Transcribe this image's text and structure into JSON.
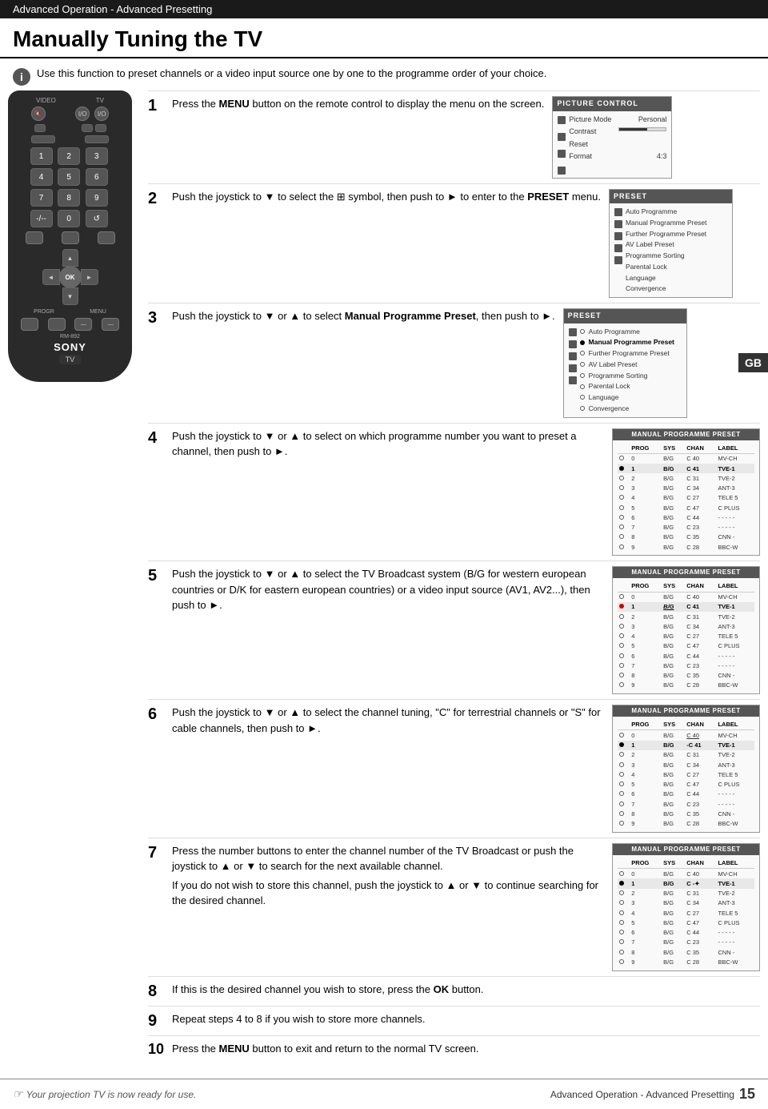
{
  "header": {
    "subtitle": "Advanced Operation - Advanced Presetting",
    "title": "Manually Tuning the TV"
  },
  "intro": {
    "text": "Use this function to preset channels or a video input source one by one to the programme order of your choice."
  },
  "steps": [
    {
      "number": "1",
      "text": "Press the MENU button on the remote control to display the menu on the screen."
    },
    {
      "number": "2",
      "text": "Push the joystick to ▼ to select the  symbol, then push to ► to enter to the PRESET menu."
    },
    {
      "number": "3",
      "text": "Push the joystick to ▼ or ▲ to select Manual Programme Preset, then push to ►."
    },
    {
      "number": "4",
      "text": "Push the joystick to ▼ or ▲ to select on which programme number you want to preset a channel, then push to ►."
    },
    {
      "number": "5",
      "text": "Push the joystick to ▼ or ▲ to select the TV Broadcast system (B/G for western european countries or D/K for eastern european countries) or a video input source (AV1, AV2...), then push to ►."
    },
    {
      "number": "6",
      "text": "Push the joystick to ▼ or ▲ to select the channel tuning, \"C\" for terrestrial channels or \"S\" for cable channels, then push to ►."
    },
    {
      "number": "7",
      "text1": "Press the number buttons to enter the channel number of the TV Broadcast or push the joystick to ▲ or ▼ to search for the next available channel.",
      "text2": "If you do not wish to store this channel, push the joystick to ▲ or ▼ to continue searching for the desired channel."
    },
    {
      "number": "8",
      "text": "If this is the desired channel you wish to store, press the OK button."
    },
    {
      "number": "9",
      "text": "Repeat steps 4 to 8 if you wish to store more channels."
    },
    {
      "number": "10",
      "text": "Press the MENU button to exit and return to the normal TV screen."
    }
  ],
  "picture_control": {
    "title": "PICTURE CONTROL",
    "items": [
      {
        "label": "Picture Mode",
        "value": "Personal"
      },
      {
        "label": "Contrast",
        "value": "bar"
      },
      {
        "label": "Reset",
        "value": ""
      },
      {
        "label": "Format",
        "value": "4:3"
      }
    ]
  },
  "preset_menu_1": {
    "title": "PRESET",
    "items": [
      "Auto Programme",
      "Manual Programme Preset",
      "Further Programme Preset",
      "AV Label Preset",
      "Programme Sorting",
      "Parental Lock",
      "Language",
      "Convergence"
    ]
  },
  "preset_menu_2": {
    "title": "PRESET",
    "items": [
      {
        "label": "Auto Programme",
        "selected": false
      },
      {
        "label": "Manual Programme Preset",
        "selected": true
      },
      {
        "label": "Further Programme Preset",
        "selected": false
      },
      {
        "label": "AV Label Preset",
        "selected": false
      },
      {
        "label": "Programme Sorting",
        "selected": false
      },
      {
        "label": "Parental Lock",
        "selected": false
      },
      {
        "label": "Language",
        "selected": false
      },
      {
        "label": "Convergence",
        "selected": false
      }
    ]
  },
  "mpp_table": {
    "title": "MANUAL PROGRAMME PRESET",
    "headers": [
      "PROG",
      "SYS",
      "CHAN",
      "LABEL"
    ],
    "rows": [
      {
        "prog": "0",
        "sys": "B/G",
        "chan": "C 40",
        "label": "MV-CH",
        "state": "empty"
      },
      {
        "prog": "1",
        "sys": "B/G",
        "chan": "C 41",
        "label": "TVE-1",
        "state": "filled"
      },
      {
        "prog": "2",
        "sys": "B/G",
        "chan": "C 31",
        "label": "TVE-2",
        "state": "empty"
      },
      {
        "prog": "3",
        "sys": "B/G",
        "chan": "C 34",
        "label": "ANT-3",
        "state": "empty"
      },
      {
        "prog": "4",
        "sys": "B/G",
        "chan": "C 27",
        "label": "TELE 5",
        "state": "empty"
      },
      {
        "prog": "5",
        "sys": "B/G",
        "chan": "C 47",
        "label": "C PLUS",
        "state": "empty"
      },
      {
        "prog": "6",
        "sys": "B/G",
        "chan": "C 44",
        "label": "- - - - -",
        "state": "empty"
      },
      {
        "prog": "7",
        "sys": "B/G",
        "chan": "C 23",
        "label": "- - - - -",
        "state": "empty"
      },
      {
        "prog": "8",
        "sys": "B/G",
        "chan": "C 35",
        "label": "CNN -",
        "state": "empty"
      },
      {
        "prog": "9",
        "sys": "B/G",
        "chan": "C 28",
        "label": "BBC-W",
        "state": "empty"
      }
    ]
  },
  "mpp_table_5": {
    "title": "MANUAL PROGRAMME PRESET",
    "highlight_row": 1,
    "rows": [
      {
        "prog": "0",
        "sys": "B/G",
        "chan": "C 40",
        "label": "MV-CH",
        "state": "empty"
      },
      {
        "prog": "1",
        "sys": "-B/G-",
        "chan": "C 41",
        "label": "TVE-1",
        "state": "filled-red"
      },
      {
        "prog": "2",
        "sys": "B/G",
        "chan": "C 31",
        "label": "TVE-2",
        "state": "empty"
      },
      {
        "prog": "3",
        "sys": "B/G",
        "chan": "C 34",
        "label": "ANT-3",
        "state": "empty"
      },
      {
        "prog": "4",
        "sys": "B/G",
        "chan": "C 27",
        "label": "TELE 5",
        "state": "empty"
      },
      {
        "prog": "5",
        "sys": "B/G",
        "chan": "C 47",
        "label": "C PLUS",
        "state": "empty"
      },
      {
        "prog": "6",
        "sys": "B/G",
        "chan": "C 44",
        "label": "- - - - -",
        "state": "empty"
      },
      {
        "prog": "7",
        "sys": "B/G",
        "chan": "C 23",
        "label": "- - - - -",
        "state": "empty"
      },
      {
        "prog": "8",
        "sys": "B/G",
        "chan": "C 35",
        "label": "CNN -",
        "state": "empty"
      },
      {
        "prog": "9",
        "sys": "B/G",
        "chan": "C 28",
        "label": "BBC-W",
        "state": "empty"
      }
    ]
  },
  "mpp_table_6": {
    "title": "MANUAL PROGRAMME PRESET",
    "rows": [
      {
        "prog": "0",
        "sys": "B/G",
        "chan": "-C 40",
        "label": "MV-CH",
        "state": "empty"
      },
      {
        "prog": "1",
        "sys": "B/G",
        "chan": "-C 41",
        "label": "TVE-1",
        "state": "filled"
      },
      {
        "prog": "2",
        "sys": "B/G",
        "chan": "C 31",
        "label": "TVE-2",
        "state": "empty"
      },
      {
        "prog": "3",
        "sys": "B/G",
        "chan": "C 34",
        "label": "ANT-3",
        "state": "empty"
      },
      {
        "prog": "4",
        "sys": "B/G",
        "chan": "C 27",
        "label": "TELE 5",
        "state": "empty"
      },
      {
        "prog": "5",
        "sys": "B/G",
        "chan": "C 47",
        "label": "C PLUS",
        "state": "empty"
      },
      {
        "prog": "6",
        "sys": "B/G",
        "chan": "C 44",
        "label": "- - - - -",
        "state": "empty"
      },
      {
        "prog": "7",
        "sys": "B/G",
        "chan": "C 23",
        "label": "- - - - -",
        "state": "empty"
      },
      {
        "prog": "8",
        "sys": "B/G",
        "chan": "C 35",
        "label": "CNN -",
        "state": "empty"
      },
      {
        "prog": "9",
        "sys": "B/G",
        "chan": "C 28",
        "label": "BBC-W",
        "state": "empty"
      }
    ]
  },
  "mpp_table_7": {
    "title": "MANUAL PROGRAMME PRESET",
    "rows": [
      {
        "prog": "0",
        "sys": "B/G",
        "chan": "C 40",
        "label": "MV-CH",
        "state": "empty"
      },
      {
        "prog": "1",
        "sys": "B/G",
        "chan": "C -",
        "label": "TVE-1",
        "state": "filled"
      },
      {
        "prog": "2",
        "sys": "B/G",
        "chan": "C 31",
        "label": "TVE-2",
        "state": "empty"
      },
      {
        "prog": "3",
        "sys": "B/G",
        "chan": "C 34",
        "label": "ANT-3",
        "state": "empty"
      },
      {
        "prog": "4",
        "sys": "B/G",
        "chan": "C 27",
        "label": "TELE 5",
        "state": "empty"
      },
      {
        "prog": "5",
        "sys": "B/G",
        "chan": "C 47",
        "label": "C PLUS",
        "state": "empty"
      },
      {
        "prog": "6",
        "sys": "B/G",
        "chan": "C 44",
        "label": "- - - - -",
        "state": "empty"
      },
      {
        "prog": "7",
        "sys": "B/G",
        "chan": "C 23",
        "label": "- - - - -",
        "state": "empty"
      },
      {
        "prog": "8",
        "sys": "B/G",
        "chan": "C 35",
        "label": "CNN -",
        "state": "empty"
      },
      {
        "prog": "9",
        "sys": "B/G",
        "chan": "C 28",
        "label": "BBC-W",
        "state": "empty"
      }
    ]
  },
  "remote": {
    "top_labels": [
      "VIDEO",
      "TV"
    ],
    "model": "RM-892",
    "brand": "SONY",
    "tv": "TV",
    "ok_label": "OK",
    "progr_label": "PROGR",
    "menu_label": "MENU"
  },
  "footer": {
    "note": "Your projection TV is now ready for use.",
    "page_label": "Advanced Operation - Advanced Presetting",
    "page_number": "15"
  },
  "gb_badge": "GB"
}
